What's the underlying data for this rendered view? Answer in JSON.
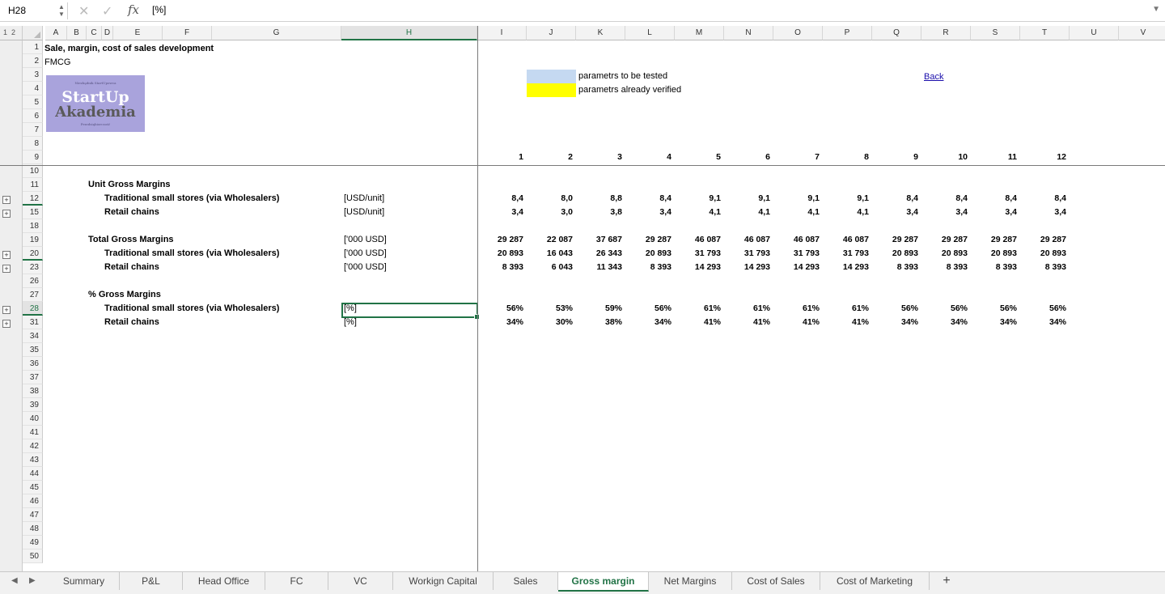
{
  "formula_bar": {
    "cell_ref": "H28",
    "formula": "[%]"
  },
  "outline_levels": [
    "1",
    "2"
  ],
  "columns": [
    "A",
    "B",
    "C",
    "D",
    "E",
    "F",
    "G",
    "H",
    "I",
    "J",
    "K",
    "L",
    "M",
    "N",
    "O",
    "P",
    "Q",
    "R",
    "S",
    "T",
    "U",
    "V"
  ],
  "rows": [
    "1",
    "2",
    "3",
    "4",
    "5",
    "6",
    "7",
    "8",
    "9",
    "10",
    "11",
    "12",
    "15",
    "18",
    "19",
    "20",
    "23",
    "26",
    "27",
    "28",
    "31",
    "34",
    "35",
    "36",
    "37",
    "38",
    "39",
    "40",
    "41",
    "42",
    "43",
    "44",
    "45",
    "46",
    "47",
    "48",
    "49",
    "50"
  ],
  "header": {
    "title": "Sale, margin, cost of sales development",
    "subtitle": "FMCG",
    "logo": {
      "top_text": "Niezbędnik StartUpowca",
      "line1": "StartUp",
      "line2": "Akademia",
      "bottom_text": "Przedsiębiorczość"
    }
  },
  "legend": {
    "tested_label": "parametrs to be tested",
    "verified_label": "parametrs already verified",
    "tested_color": "#c5d9f1",
    "verified_color": "#ffff00"
  },
  "back_link": "Back",
  "periods": [
    "1",
    "2",
    "3",
    "4",
    "5",
    "6",
    "7",
    "8",
    "9",
    "10",
    "11",
    "12"
  ],
  "sections": {
    "unit": {
      "title": "Unit Gross Margins",
      "rows": [
        {
          "label": "Traditional small stores (via Wholesalers)",
          "unit": "[USD/unit]",
          "values": [
            "8,4",
            "8,0",
            "8,8",
            "8,4",
            "9,1",
            "9,1",
            "9,1",
            "9,1",
            "8,4",
            "8,4",
            "8,4",
            "8,4"
          ]
        },
        {
          "label": "Retail chains",
          "unit": "[USD/unit]",
          "values": [
            "3,4",
            "3,0",
            "3,8",
            "3,4",
            "4,1",
            "4,1",
            "4,1",
            "4,1",
            "3,4",
            "3,4",
            "3,4",
            "3,4"
          ]
        }
      ]
    },
    "total": {
      "title": "Total Gross Margins",
      "unit": "['000 USD]",
      "values": [
        "29 287",
        "22 087",
        "37 687",
        "29 287",
        "46 087",
        "46 087",
        "46 087",
        "46 087",
        "29 287",
        "29 287",
        "29 287",
        "29 287"
      ],
      "rows": [
        {
          "label": "Traditional small stores (via Wholesalers)",
          "unit": "['000 USD]",
          "values": [
            "20 893",
            "16 043",
            "26 343",
            "20 893",
            "31 793",
            "31 793",
            "31 793",
            "31 793",
            "20 893",
            "20 893",
            "20 893",
            "20 893"
          ]
        },
        {
          "label": "Retail chains",
          "unit": "['000 USD]",
          "values": [
            "8 393",
            "6 043",
            "11 343",
            "8 393",
            "14 293",
            "14 293",
            "14 293",
            "14 293",
            "8 393",
            "8 393",
            "8 393",
            "8 393"
          ]
        }
      ]
    },
    "percent": {
      "title": "% Gross Margins",
      "rows": [
        {
          "label": "Traditional small stores (via Wholesalers)",
          "unit": "[%]",
          "values": [
            "56%",
            "53%",
            "59%",
            "56%",
            "61%",
            "61%",
            "61%",
            "61%",
            "56%",
            "56%",
            "56%",
            "56%"
          ]
        },
        {
          "label": "Retail chains",
          "unit": "[%]",
          "values": [
            "34%",
            "30%",
            "38%",
            "34%",
            "41%",
            "41%",
            "41%",
            "41%",
            "34%",
            "34%",
            "34%",
            "34%"
          ]
        }
      ]
    }
  },
  "sheet_tabs": [
    "Summary",
    "P&L",
    "Head Office",
    "FC",
    "VC",
    "Workign Capital",
    "Sales",
    "Gross margin",
    "Net Margins",
    "Cost of Sales",
    "Cost of Marketing"
  ],
  "active_tab": "Gross margin",
  "add_tab": "+"
}
